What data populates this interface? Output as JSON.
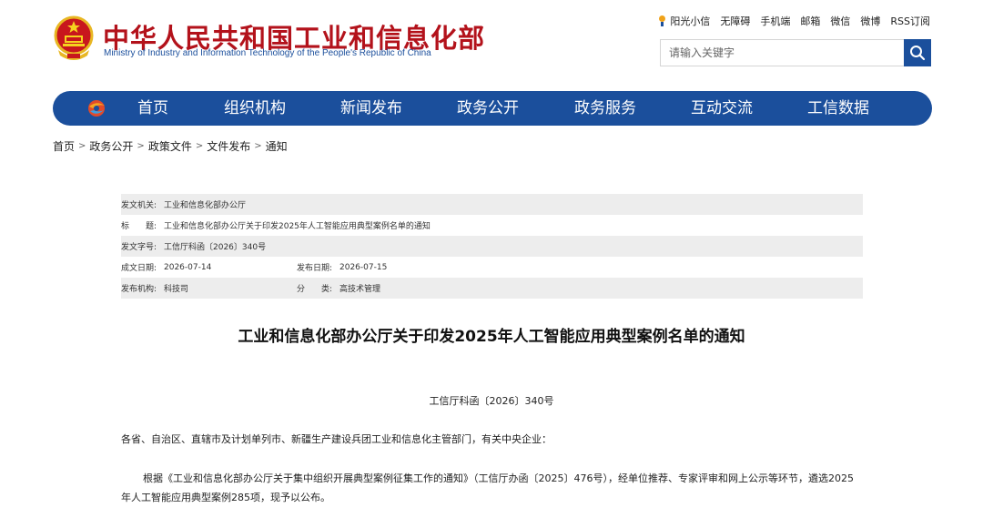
{
  "site": {
    "title_cn": "中华人民共和国工业和信息化部",
    "title_en": "Ministry of Industry and Information Technology of the People's Republic of China"
  },
  "toplinks": [
    "阳光小信",
    "无障碍",
    "手机端",
    "邮箱",
    "微信",
    "微博",
    "RSS订阅"
  ],
  "search": {
    "placeholder": "请输入关键字"
  },
  "nav": {
    "items": [
      "首页",
      "组织机构",
      "新闻发布",
      "政务公开",
      "政务服务",
      "互动交流",
      "工信数据"
    ]
  },
  "breadcrumb": [
    "首页",
    "政务公开",
    "政策文件",
    "文件发布",
    "通知"
  ],
  "meta": {
    "issuer_label": "发文机关:",
    "issuer": "工业和信息化部办公厅",
    "title_label": "标　　题:",
    "title": "工业和信息化部办公厅关于印发2025年人工智能应用典型案例名单的通知",
    "docno_label": "发文字号:",
    "docno": "工信厅科函〔2026〕340号",
    "created_label": "成文日期:",
    "created": "2026-07-14",
    "published_label": "发布日期:",
    "published": "2026-07-15",
    "org_label": "发布机构:",
    "org": "科技司",
    "category_label": "分　　类:",
    "category": "高技术管理"
  },
  "article": {
    "title": "工业和信息化部办公厅关于印发2025年人工智能应用典型案例名单的通知",
    "doc_number": "工信厅科函〔2026〕340号",
    "recipients": "各省、自治区、直辖市及计划单列市、新疆生产建设兵团工业和信息化主管部门，有关中央企业：",
    "body": "根据《工业和信息化部办公厅关于集中组织开展典型案例征集工作的通知》（工信厅办函〔2025〕476号），经单位推荐、专家评审和网上公示等环节，遴选2025年人工智能应用典型案例285项，现予以公布。"
  },
  "colors": {
    "brand_blue": "#1b4f9c",
    "title_red": "#b3121b",
    "meta_shade": "#ededed"
  }
}
